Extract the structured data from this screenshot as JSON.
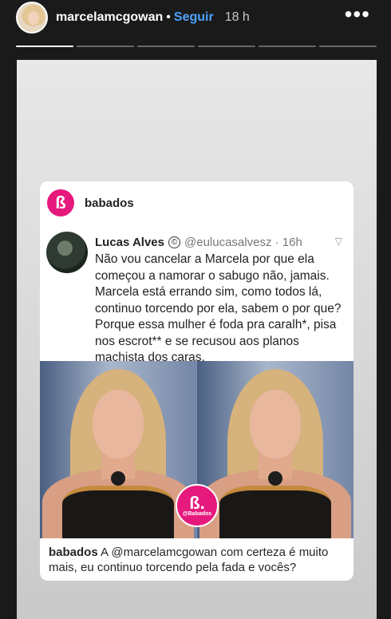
{
  "header": {
    "username": "marcelamcgowan",
    "separator": "•",
    "follow_label": "Seguir",
    "time": "18 h",
    "more_icon": "more-horizontal-icon"
  },
  "progress": [
    1,
    0,
    0,
    0,
    0,
    0
  ],
  "post": {
    "brand_name": "babados",
    "brand_logo_letter": "ß",
    "tweet": {
      "name": "Lucas Alves",
      "copyright": "©",
      "handle_time": "@eulucasalvesz · 16h",
      "chevron": "▽",
      "text": "Não vou cancelar a Marcela por que ela começou a namorar o sabugo não, jamais. Marcela está errando sim, como todos lá, continuo torcendo por ela, sabem o por que? Porque essa mulher é foda pra caralh*, pisa nos escrot** e se recusou aos planos machista dos caras."
    },
    "badge": {
      "letter": "ß.",
      "text": "@Babados"
    },
    "caption": {
      "author": "babados",
      "text": "A @marcelamcgowan com certeza é muito mais, eu continuo torcendo pela fada e vocês?"
    }
  }
}
